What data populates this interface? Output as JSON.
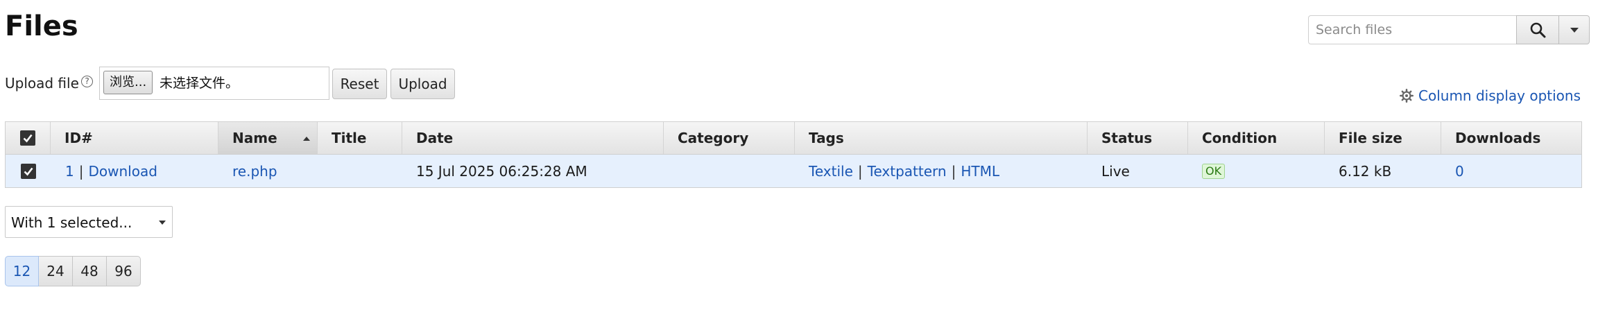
{
  "page": {
    "title": "Files"
  },
  "search": {
    "placeholder": "Search files",
    "search_icon": "search-icon",
    "dropdown_icon": "chevron-down-icon"
  },
  "upload": {
    "label": "Upload file",
    "help_glyph": "?",
    "browse_label": "浏览...",
    "file_status": "未选择文件。",
    "reset_label": "Reset",
    "upload_label": "Upload"
  },
  "column_options": {
    "label": "Column display options",
    "icon": "gear-icon"
  },
  "table": {
    "headers": {
      "id": "ID#",
      "name": "Name",
      "title": "Title",
      "date": "Date",
      "category": "Category",
      "tags": "Tags",
      "status": "Status",
      "condition": "Condition",
      "filesize": "File size",
      "downloads": "Downloads"
    },
    "sorted_column": "Name",
    "sort_direction": "ascending",
    "rows": [
      {
        "selected": true,
        "id": "1",
        "id_sep": "|",
        "download_label": "Download",
        "name": "re.php",
        "title": "",
        "date": "15 Jul 2025 06:25:28 AM",
        "category": "",
        "tags": [
          "Textile",
          "Textpattern",
          "HTML"
        ],
        "tag_sep": "|",
        "status": "Live",
        "condition": "OK",
        "filesize": "6.12 kB",
        "downloads": "0"
      }
    ]
  },
  "bulk": {
    "label": "With 1 selected..."
  },
  "pagesize": {
    "options": [
      "12",
      "24",
      "48",
      "96"
    ],
    "active": "12"
  },
  "colors": {
    "link": "#1a56b3",
    "selected_row": "#e6f0fd",
    "ok_badge_bg": "#dff6d8",
    "ok_badge_text": "#2b7a14"
  }
}
